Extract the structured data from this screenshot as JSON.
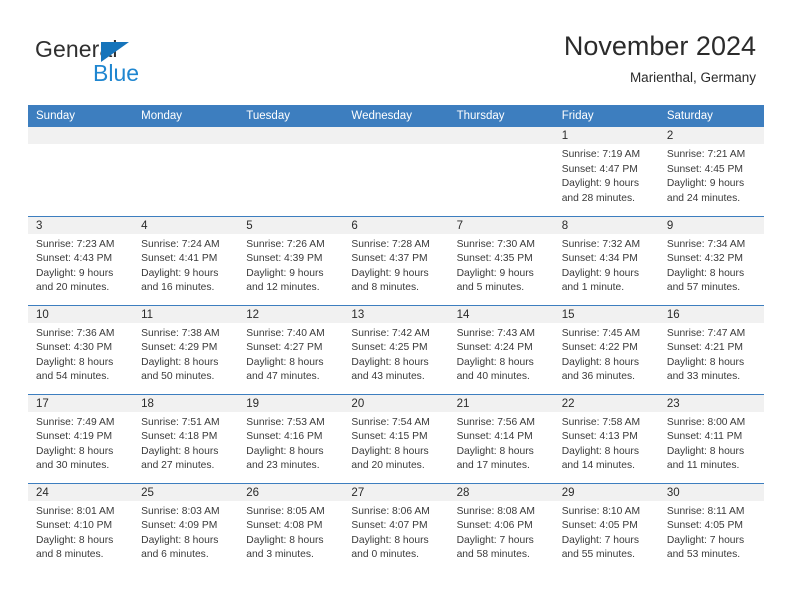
{
  "brand": {
    "name_part1": "General",
    "name_part2": "Blue",
    "triangle_icon": "blue-triangle-logo-mark"
  },
  "header": {
    "title": "November 2024",
    "subtitle": "Marienthal, Germany"
  },
  "colors": {
    "header_blue": "#3d7ebf",
    "logo_blue": "#1f86d0",
    "daynum_strip": "#f1f1f1",
    "text": "#2b2b2b"
  },
  "weekday_headers": [
    "Sunday",
    "Monday",
    "Tuesday",
    "Wednesday",
    "Thursday",
    "Friday",
    "Saturday"
  ],
  "weeks": [
    [
      {
        "empty": true
      },
      {
        "empty": true
      },
      {
        "empty": true
      },
      {
        "empty": true
      },
      {
        "empty": true
      },
      {
        "day": "1",
        "sunrise": "Sunrise: 7:19 AM",
        "sunset": "Sunset: 4:47 PM",
        "daylight_line1": "Daylight: 9 hours",
        "daylight_line2": "and 28 minutes."
      },
      {
        "day": "2",
        "sunrise": "Sunrise: 7:21 AM",
        "sunset": "Sunset: 4:45 PM",
        "daylight_line1": "Daylight: 9 hours",
        "daylight_line2": "and 24 minutes."
      }
    ],
    [
      {
        "day": "3",
        "sunrise": "Sunrise: 7:23 AM",
        "sunset": "Sunset: 4:43 PM",
        "daylight_line1": "Daylight: 9 hours",
        "daylight_line2": "and 20 minutes."
      },
      {
        "day": "4",
        "sunrise": "Sunrise: 7:24 AM",
        "sunset": "Sunset: 4:41 PM",
        "daylight_line1": "Daylight: 9 hours",
        "daylight_line2": "and 16 minutes."
      },
      {
        "day": "5",
        "sunrise": "Sunrise: 7:26 AM",
        "sunset": "Sunset: 4:39 PM",
        "daylight_line1": "Daylight: 9 hours",
        "daylight_line2": "and 12 minutes."
      },
      {
        "day": "6",
        "sunrise": "Sunrise: 7:28 AM",
        "sunset": "Sunset: 4:37 PM",
        "daylight_line1": "Daylight: 9 hours",
        "daylight_line2": "and 8 minutes."
      },
      {
        "day": "7",
        "sunrise": "Sunrise: 7:30 AM",
        "sunset": "Sunset: 4:35 PM",
        "daylight_line1": "Daylight: 9 hours",
        "daylight_line2": "and 5 minutes."
      },
      {
        "day": "8",
        "sunrise": "Sunrise: 7:32 AM",
        "sunset": "Sunset: 4:34 PM",
        "daylight_line1": "Daylight: 9 hours",
        "daylight_line2": "and 1 minute."
      },
      {
        "day": "9",
        "sunrise": "Sunrise: 7:34 AM",
        "sunset": "Sunset: 4:32 PM",
        "daylight_line1": "Daylight: 8 hours",
        "daylight_line2": "and 57 minutes."
      }
    ],
    [
      {
        "day": "10",
        "sunrise": "Sunrise: 7:36 AM",
        "sunset": "Sunset: 4:30 PM",
        "daylight_line1": "Daylight: 8 hours",
        "daylight_line2": "and 54 minutes."
      },
      {
        "day": "11",
        "sunrise": "Sunrise: 7:38 AM",
        "sunset": "Sunset: 4:29 PM",
        "daylight_line1": "Daylight: 8 hours",
        "daylight_line2": "and 50 minutes."
      },
      {
        "day": "12",
        "sunrise": "Sunrise: 7:40 AM",
        "sunset": "Sunset: 4:27 PM",
        "daylight_line1": "Daylight: 8 hours",
        "daylight_line2": "and 47 minutes."
      },
      {
        "day": "13",
        "sunrise": "Sunrise: 7:42 AM",
        "sunset": "Sunset: 4:25 PM",
        "daylight_line1": "Daylight: 8 hours",
        "daylight_line2": "and 43 minutes."
      },
      {
        "day": "14",
        "sunrise": "Sunrise: 7:43 AM",
        "sunset": "Sunset: 4:24 PM",
        "daylight_line1": "Daylight: 8 hours",
        "daylight_line2": "and 40 minutes."
      },
      {
        "day": "15",
        "sunrise": "Sunrise: 7:45 AM",
        "sunset": "Sunset: 4:22 PM",
        "daylight_line1": "Daylight: 8 hours",
        "daylight_line2": "and 36 minutes."
      },
      {
        "day": "16",
        "sunrise": "Sunrise: 7:47 AM",
        "sunset": "Sunset: 4:21 PM",
        "daylight_line1": "Daylight: 8 hours",
        "daylight_line2": "and 33 minutes."
      }
    ],
    [
      {
        "day": "17",
        "sunrise": "Sunrise: 7:49 AM",
        "sunset": "Sunset: 4:19 PM",
        "daylight_line1": "Daylight: 8 hours",
        "daylight_line2": "and 30 minutes."
      },
      {
        "day": "18",
        "sunrise": "Sunrise: 7:51 AM",
        "sunset": "Sunset: 4:18 PM",
        "daylight_line1": "Daylight: 8 hours",
        "daylight_line2": "and 27 minutes."
      },
      {
        "day": "19",
        "sunrise": "Sunrise: 7:53 AM",
        "sunset": "Sunset: 4:16 PM",
        "daylight_line1": "Daylight: 8 hours",
        "daylight_line2": "and 23 minutes."
      },
      {
        "day": "20",
        "sunrise": "Sunrise: 7:54 AM",
        "sunset": "Sunset: 4:15 PM",
        "daylight_line1": "Daylight: 8 hours",
        "daylight_line2": "and 20 minutes."
      },
      {
        "day": "21",
        "sunrise": "Sunrise: 7:56 AM",
        "sunset": "Sunset: 4:14 PM",
        "daylight_line1": "Daylight: 8 hours",
        "daylight_line2": "and 17 minutes."
      },
      {
        "day": "22",
        "sunrise": "Sunrise: 7:58 AM",
        "sunset": "Sunset: 4:13 PM",
        "daylight_line1": "Daylight: 8 hours",
        "daylight_line2": "and 14 minutes."
      },
      {
        "day": "23",
        "sunrise": "Sunrise: 8:00 AM",
        "sunset": "Sunset: 4:11 PM",
        "daylight_line1": "Daylight: 8 hours",
        "daylight_line2": "and 11 minutes."
      }
    ],
    [
      {
        "day": "24",
        "sunrise": "Sunrise: 8:01 AM",
        "sunset": "Sunset: 4:10 PM",
        "daylight_line1": "Daylight: 8 hours",
        "daylight_line2": "and 8 minutes."
      },
      {
        "day": "25",
        "sunrise": "Sunrise: 8:03 AM",
        "sunset": "Sunset: 4:09 PM",
        "daylight_line1": "Daylight: 8 hours",
        "daylight_line2": "and 6 minutes."
      },
      {
        "day": "26",
        "sunrise": "Sunrise: 8:05 AM",
        "sunset": "Sunset: 4:08 PM",
        "daylight_line1": "Daylight: 8 hours",
        "daylight_line2": "and 3 minutes."
      },
      {
        "day": "27",
        "sunrise": "Sunrise: 8:06 AM",
        "sunset": "Sunset: 4:07 PM",
        "daylight_line1": "Daylight: 8 hours",
        "daylight_line2": "and 0 minutes."
      },
      {
        "day": "28",
        "sunrise": "Sunrise: 8:08 AM",
        "sunset": "Sunset: 4:06 PM",
        "daylight_line1": "Daylight: 7 hours",
        "daylight_line2": "and 58 minutes."
      },
      {
        "day": "29",
        "sunrise": "Sunrise: 8:10 AM",
        "sunset": "Sunset: 4:05 PM",
        "daylight_line1": "Daylight: 7 hours",
        "daylight_line2": "and 55 minutes."
      },
      {
        "day": "30",
        "sunrise": "Sunrise: 8:11 AM",
        "sunset": "Sunset: 4:05 PM",
        "daylight_line1": "Daylight: 7 hours",
        "daylight_line2": "and 53 minutes."
      }
    ]
  ]
}
